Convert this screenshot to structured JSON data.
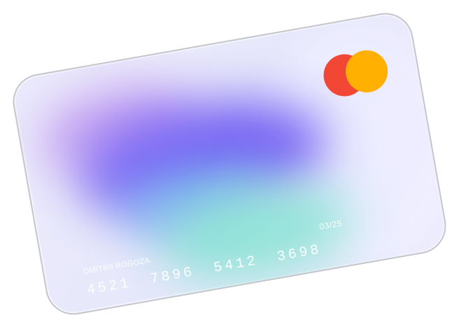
{
  "card": {
    "brand_logo": "mastercard-logo",
    "expiry": "03/25",
    "holder": "DMITRII ROGOZA",
    "number_groups": [
      "4521",
      "7896",
      "5412",
      "3698"
    ],
    "colors": {
      "mc_red": "#f24735",
      "mc_yellow": "#ffb000",
      "card_base": "#e7e7fb",
      "violet": "#b889ee",
      "indigo": "#6f59f3",
      "teal": "#88e2d4"
    }
  }
}
